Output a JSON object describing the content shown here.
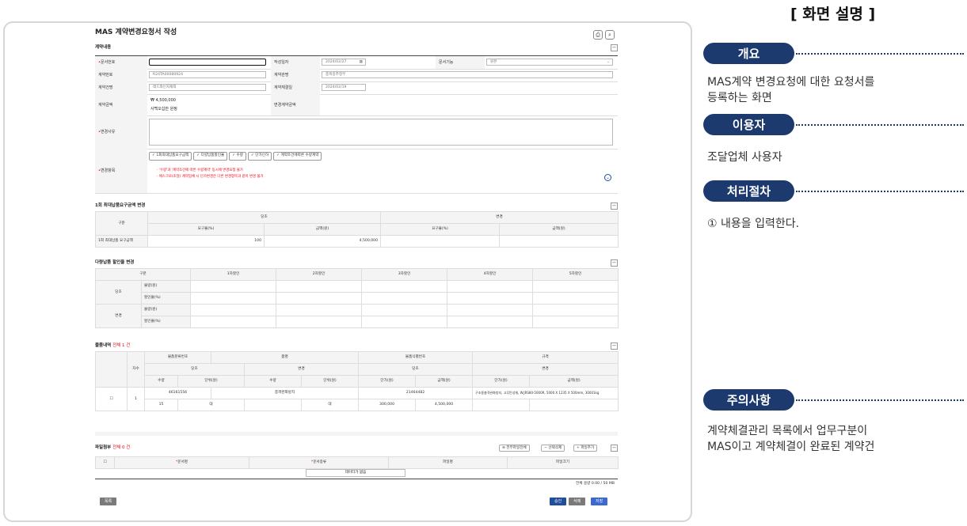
{
  "panel": {
    "title": "[ 화면 설명 ]",
    "overview_label": "개요",
    "overview_text_1": "MAS계약 변경요청에 대한 요청서를",
    "overview_text_2": "등록하는 화면",
    "user_label": "이용자",
    "user_text": "조달업체 사용자",
    "process_label": "처리절차",
    "process_text": "① 내용을 입력한다.",
    "caution_label": "주의사항",
    "caution_text_1": "계약체결관리 목록에서 업무구분이",
    "caution_text_2": "MAS이고 계약체결이 완료된 계약건"
  },
  "form": {
    "title": "MAS 계약변경요청서 작성",
    "contract_section": "계약내용",
    "doc_no_label": "문서번호",
    "write_date_label": "작성일자",
    "write_date_value": "2024/02/27",
    "doc_type_label": "문서기능",
    "doc_type_value": "원본",
    "contract_no_label": "계약번호",
    "contract_no_value": "R24TA00080924",
    "contract_org_label": "계약관명",
    "contract_org_value": "충북중추정무",
    "contract_name_label": "계약건명",
    "contract_name_value": "레드와인자재외",
    "contract_date_label": "계약체결일",
    "contract_date_value": "2024/02/19",
    "amount_label": "계약금액",
    "amount_value": "₩ 4,500,000",
    "amount_kor": "사백오십만 원정",
    "changed_amount_label": "변경계약금액",
    "reason_label": "변경사유",
    "items_label": "변경항목",
    "chips": [
      "1회최대납품요구금액",
      "다량납품할인율",
      "수량",
      "단가인하",
      "계약조건에따른 수량계약"
    ],
    "note_1": "· '수량'과 '계약조건에 따른 수량계약' 동시에 변경요청 불가",
    "note_2": "· 에스크로(조달) 계약업체 시 단가변경은 다른 변경항목과 같이 변경 불가"
  },
  "max_section": {
    "title": "1회 최대납품요구금액 변경",
    "h_gubun": "구분",
    "h_dangcho": "당초",
    "h_change": "변경",
    "h_rate": "요구율(%)",
    "h_amount": "금액(원)",
    "row_label": "1회 최대납품 요구금액",
    "rate_value": "100",
    "amount_value": "4,500,000"
  },
  "discount_section": {
    "title": "다량납품 할인율 변경",
    "h_gubun": "구분",
    "cols": [
      "1차할인",
      "2차할인",
      "3차할인",
      "4차할인",
      "5차할인"
    ],
    "dangcho": "당초",
    "change": "변경",
    "qty": "물량(원)",
    "rate": "할인율(%)"
  },
  "goods_section": {
    "title": "물품내역",
    "count_label": "전체 1 건",
    "h_item_code": "물품분류번호",
    "h_item_name": "품명",
    "h_item_id": "물품식별번호",
    "h_spec": "규격",
    "h_seq": "차수",
    "h_dangcho": "당초",
    "h_change": "변경",
    "h_qty": "수량",
    "h_unit": "단위(원)",
    "h_price": "단가(원)",
    "h_amount": "금액(원)",
    "r_code": "46161556",
    "r_name": "충격완화방지",
    "r_id": "21464482",
    "r_spec": "구조용충격완화방지, 고무탄성체, W.JRS80-5000R, 5000 X 1235 X 500mm, 30001kg",
    "r_seq": "1",
    "r_qty": "15",
    "r_unit": "대",
    "r_unit2": "대",
    "r_price": "300,000",
    "r_amount": "4,500,000"
  },
  "file_section": {
    "title": "파일첨부",
    "count_label": "전체 0 건",
    "btn_download_all": "전부파일전체",
    "btn_delete": "선택삭제",
    "btn_add": "파일추가",
    "h_doc_name": "문서명",
    "h_doc_type": "문서종류",
    "h_file_name": "파일명",
    "h_file_size": "파일크기",
    "empty_text": "데이터가 없음",
    "size_text": "전체 용량 0.00 / 50 MB"
  },
  "buttons": {
    "list": "목록",
    "approve": "승인",
    "delete": "삭제",
    "save": "저장"
  },
  "colors": {
    "pill": "#1d3a6e",
    "primary_btn": "#1f4e9c",
    "gray_btn": "#7a7a7a"
  }
}
